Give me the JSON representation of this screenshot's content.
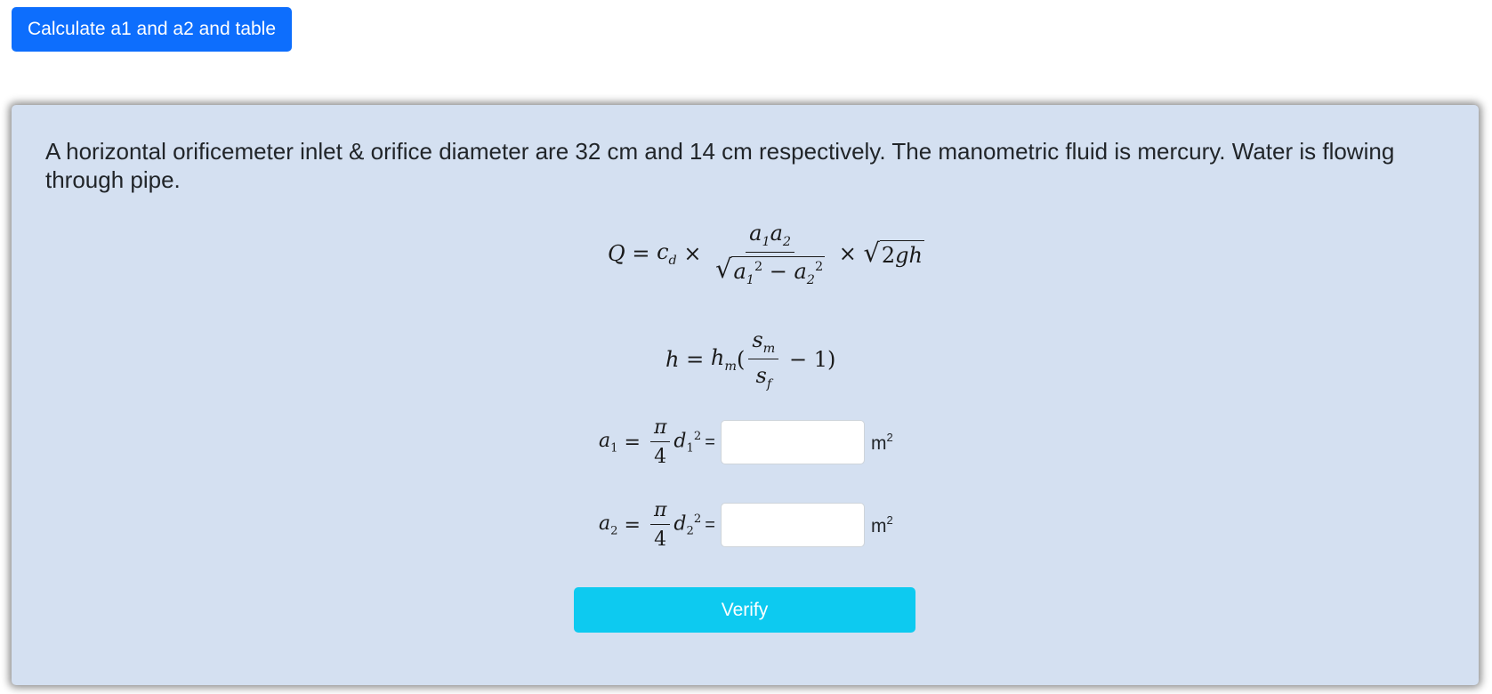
{
  "toolbar": {
    "calc_button_label": "Calculate a1 and a2 and table"
  },
  "problem": {
    "text": "A horizontal orificemeter inlet & orifice diameter are 32 cm and 14 cm respectively. The manometric fluid is mercury. Water is flowing through pipe."
  },
  "inputs": {
    "a1": {
      "value": "",
      "unit_base": "m",
      "unit_exp": "2"
    },
    "a2": {
      "value": "",
      "unit_base": "m",
      "unit_exp": "2"
    },
    "equals_sign": "="
  },
  "actions": {
    "verify_label": "Verify"
  },
  "colors": {
    "primary": "#0d6efd",
    "info": "#0dcaf0",
    "panel_bg": "#d4e0f1"
  }
}
